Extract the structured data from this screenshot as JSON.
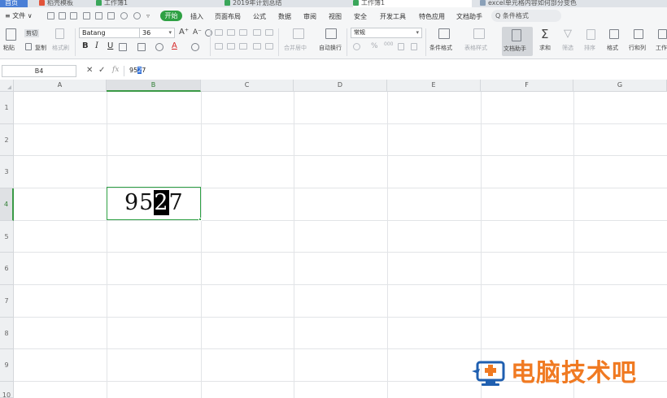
{
  "tabs": [
    "首页",
    "稻壳模板",
    "工作簿1",
    "2019年计划总结",
    "工作簿1",
    "excel单元格内容如何部分变色"
  ],
  "menu": {
    "file": "≡ 文件 ∨",
    "start": "开始",
    "items": [
      "插入",
      "页面布局",
      "公式",
      "数据",
      "审阅",
      "视图",
      "安全",
      "开发工具",
      "特色应用",
      "文档助手"
    ],
    "search": "Q 条件格式"
  },
  "ribbon": {
    "paste": "粘贴",
    "cut": "剪切",
    "copy": "复制",
    "format_painter": "格式刷",
    "font_name": "Batang",
    "font_size": "36",
    "grow_font": "A⁺",
    "shrink_font": "A⁻",
    "bold": "B",
    "italic": "I",
    "underline": "U",
    "merge_center": "合并居中",
    "wrap_text": "自动换行",
    "number_format": "常规",
    "percent": "%",
    "thousands": "000",
    "cond_format": "条件格式",
    "table_style": "表格样式",
    "doc_assistant": "文档助手",
    "sum": "求和",
    "filter": "筛选",
    "sort": "排序",
    "format": "格式",
    "row_col": "行和列",
    "worksheet": "工作"
  },
  "formula_bar": {
    "name_box": "B4",
    "cancel": "✕",
    "enter": "✓",
    "fx": "fx",
    "value_pre": "95",
    "value_sel": "2",
    "value_post": "7"
  },
  "sheet": {
    "columns": [
      "A",
      "B",
      "C",
      "D",
      "E",
      "F",
      "G"
    ],
    "rows": [
      "1",
      "2",
      "3",
      "4",
      "5",
      "6",
      "7",
      "8",
      "9",
      "10"
    ],
    "selected_column": "B",
    "selected_row": "4",
    "cell": {
      "ref": "B4",
      "text_pre": "95",
      "text_sel": "2",
      "text_post": "7"
    }
  },
  "watermark": {
    "text": "电脑技术吧",
    "color": "#f07a22"
  },
  "colors": {
    "accent": "#2ea043",
    "selection": "#2b6bd6"
  }
}
